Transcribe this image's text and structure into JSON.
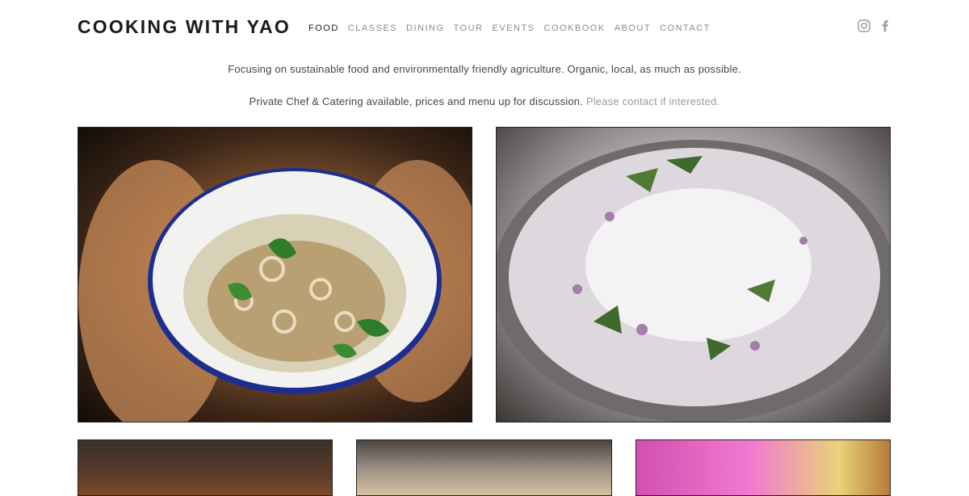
{
  "site": {
    "title": "COOKING WITH YAO"
  },
  "nav": {
    "items": [
      "FOOD",
      "CLASSES",
      "DINING",
      "TOUR",
      "EVENTS",
      "COOKBOOK",
      "ABOUT",
      "CONTACT"
    ],
    "active": "FOOD"
  },
  "social": {
    "icons": [
      "instagram-icon",
      "facebook-icon"
    ]
  },
  "intro": {
    "line1": "Focusing on sustainable food and environmentally friendly agriculture. Organic, local, as much as possible.",
    "line2_text": "Private Chef & Catering available, prices and menu up for discussion.",
    "line2_link": "Please contact if interested."
  },
  "colors": {
    "text": "#444444",
    "muted": "#999999",
    "active_nav": "#1a1a1a",
    "nav": "#8a8a8a"
  }
}
